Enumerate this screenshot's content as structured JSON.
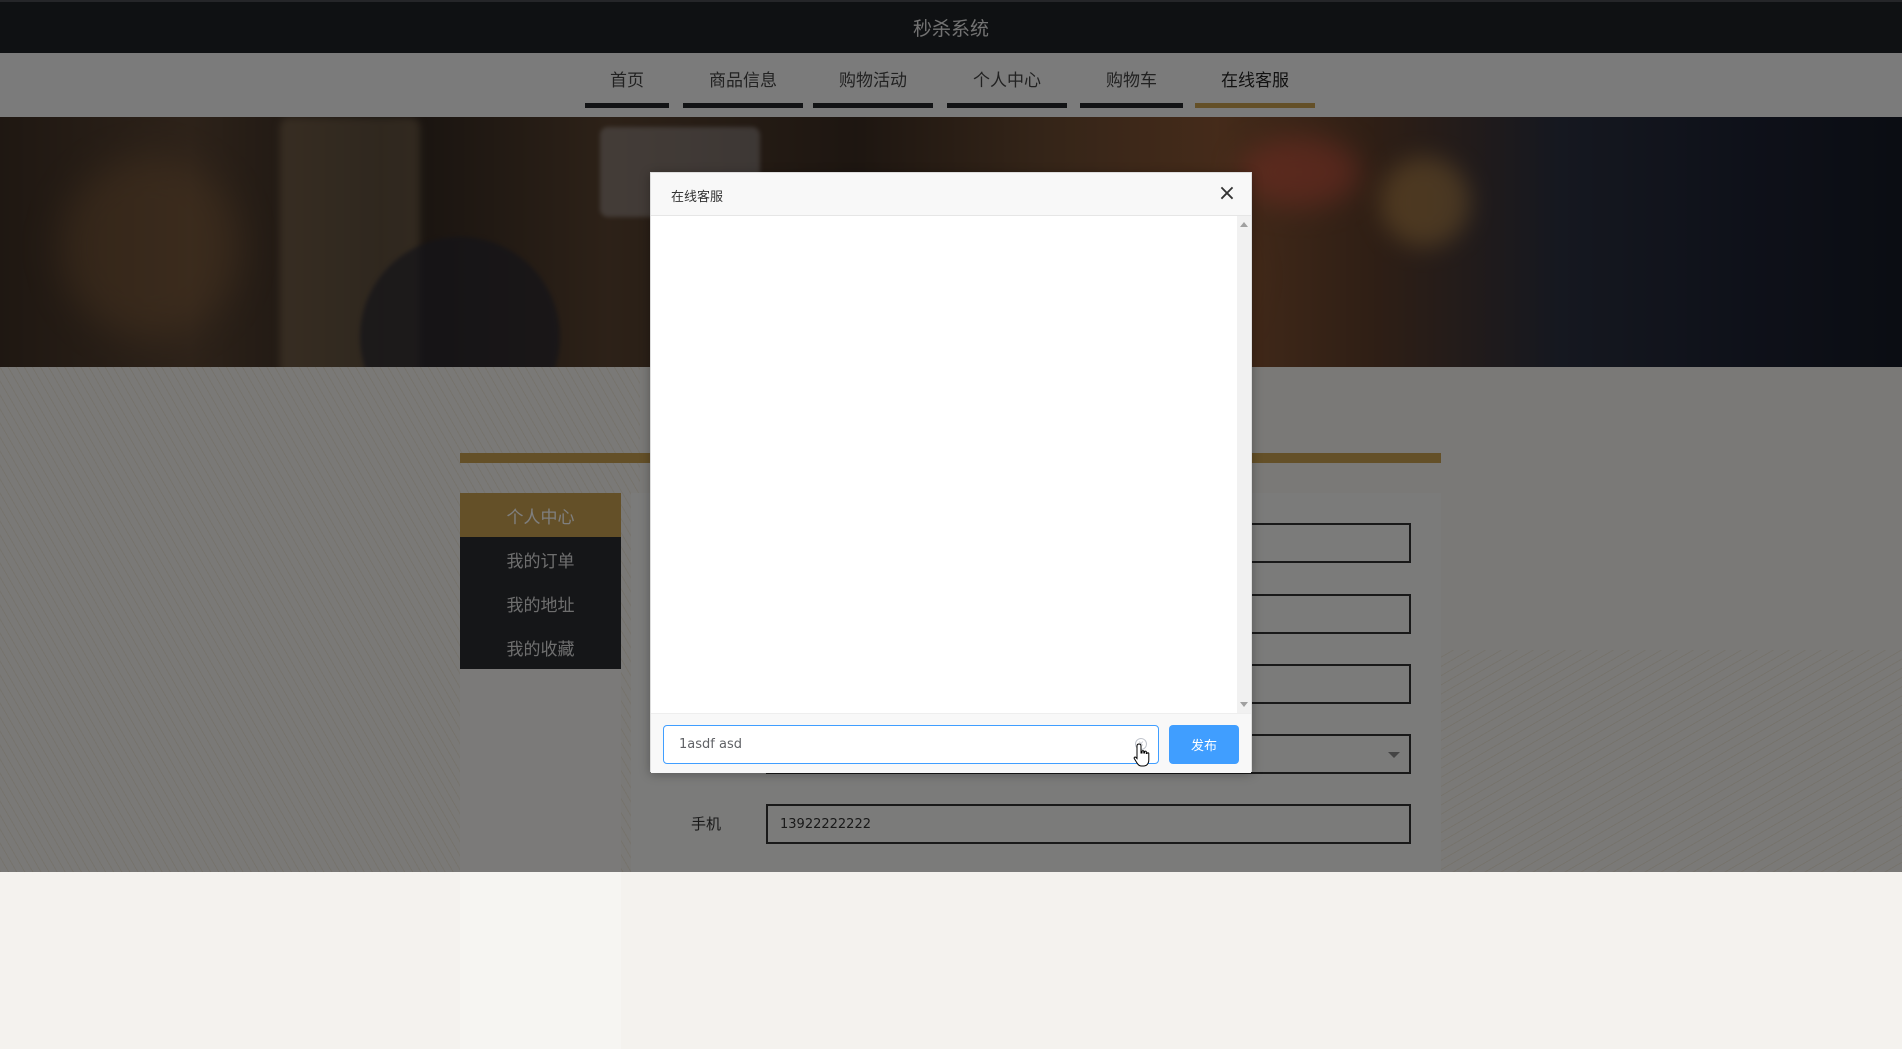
{
  "app": {
    "title": "秒杀系统"
  },
  "nav": {
    "items": [
      {
        "label": "首页"
      },
      {
        "label": "商品信息"
      },
      {
        "label": "购物活动"
      },
      {
        "label": "个人中心"
      },
      {
        "label": "购物车"
      },
      {
        "label": "在线客服",
        "active": true
      }
    ]
  },
  "sidebar": {
    "items": [
      {
        "label": "个人中心",
        "active": true
      },
      {
        "label": "我的订单"
      },
      {
        "label": "我的地址"
      },
      {
        "label": "我的收藏"
      }
    ]
  },
  "form": {
    "phone_label": "手机",
    "phone_value": "13922222222"
  },
  "dialog": {
    "title": "在线客服",
    "close_glyph": "×",
    "input_value": "1asdf asd",
    "send_label": "发布"
  },
  "colors": {
    "accent_gold": "#c9a050",
    "primary_blue": "#409eff",
    "dark_bar": "#1f2226"
  }
}
